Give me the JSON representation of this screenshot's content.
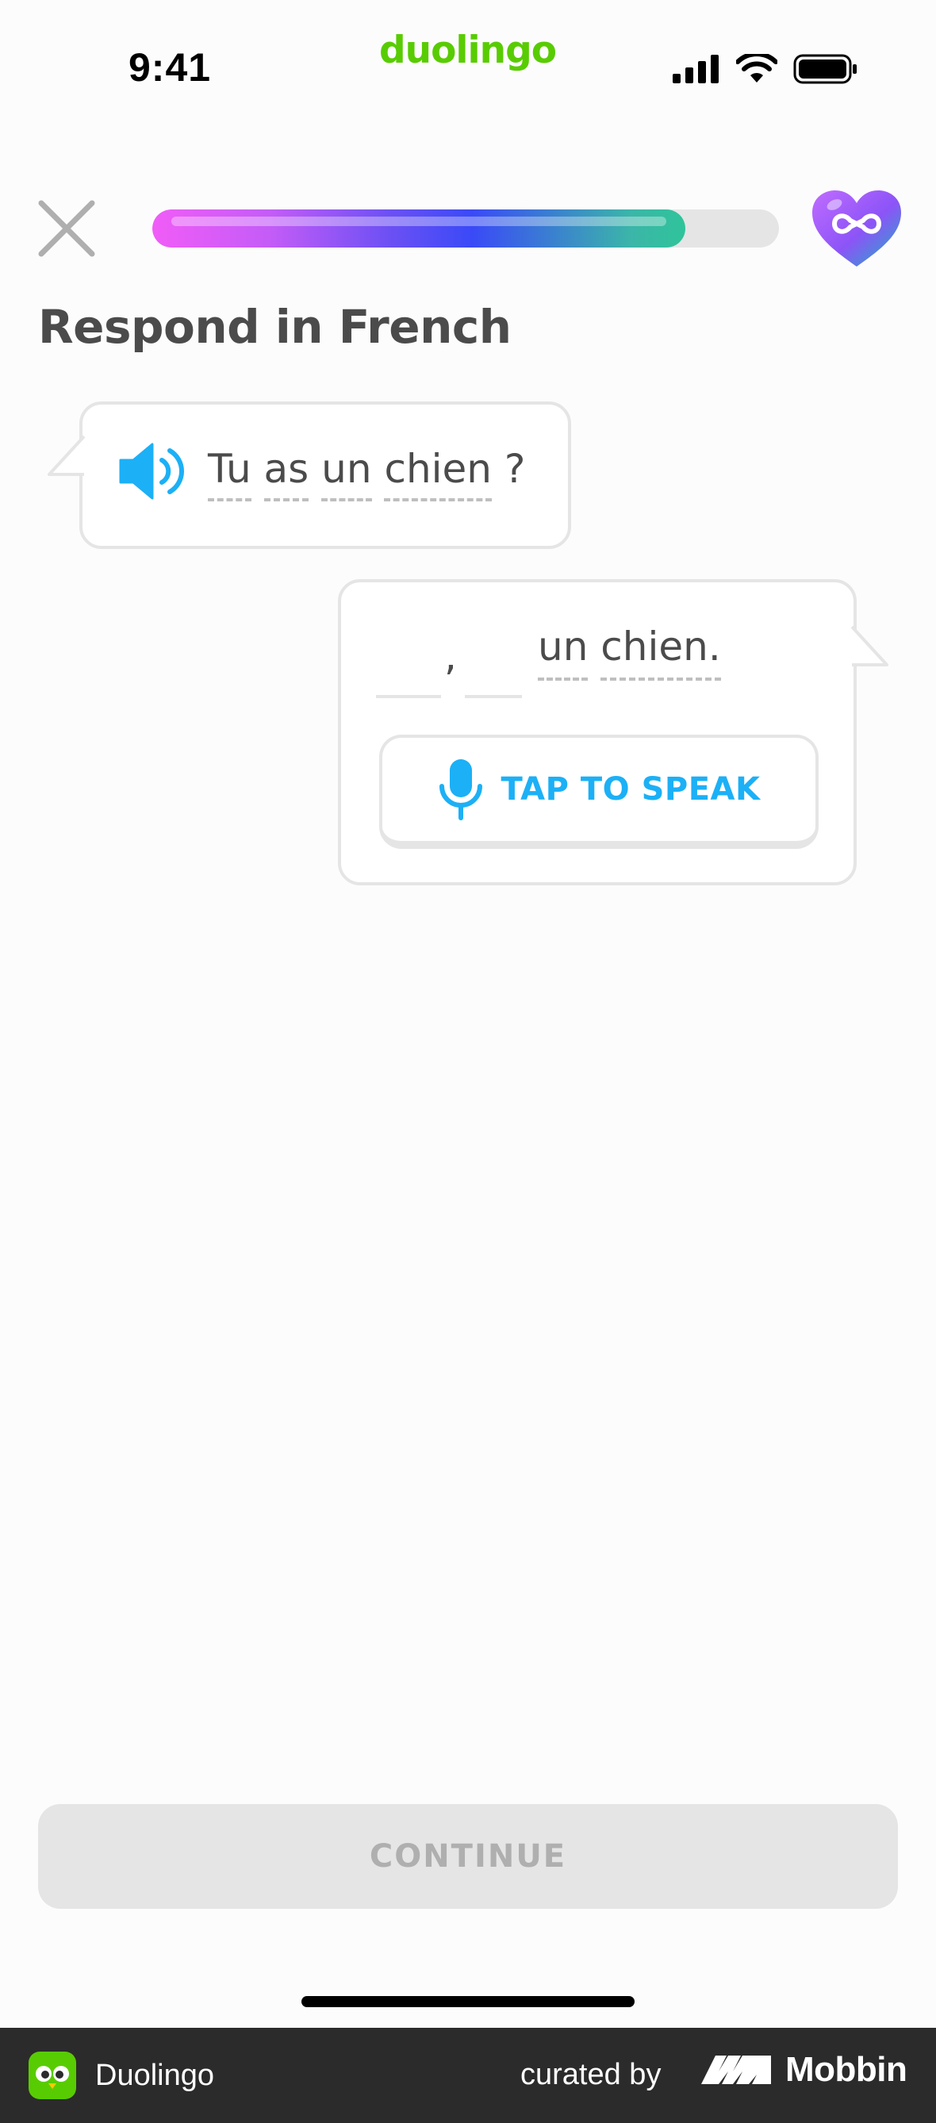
{
  "status_bar": {
    "time": "9:41",
    "brand": "duolingo"
  },
  "lesson": {
    "progress": 0.85,
    "heading": "Respond in French",
    "prompt_words": [
      "Tu",
      "as",
      "un",
      "chien",
      "?"
    ],
    "answer": {
      "comma": ",",
      "words": [
        "un",
        "chien."
      ]
    },
    "speak_label": "TAP TO SPEAK",
    "continue_label": "CONTINUE"
  },
  "footer": {
    "app_name": "Duolingo",
    "curated_by": "curated by",
    "brand": "Mobbin"
  },
  "colors": {
    "brand_green": "#58cc02",
    "blue": "#1cb0f6",
    "heart": "#a560f8"
  },
  "icons": [
    "close-icon",
    "infinity-heart-icon",
    "speaker-icon",
    "microphone-icon"
  ]
}
